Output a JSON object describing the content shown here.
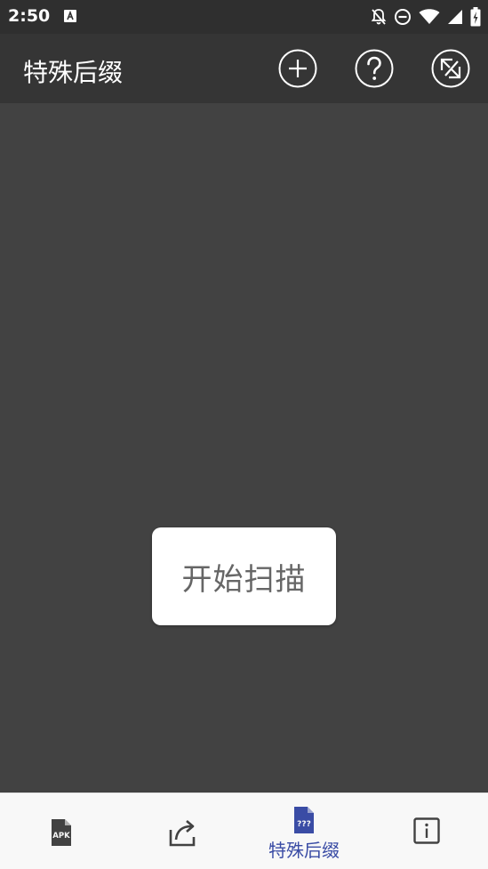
{
  "status_bar": {
    "time": "2:50"
  },
  "app_bar": {
    "title": "特殊后缀",
    "actions": [
      {
        "name": "add",
        "icon": "add-circle-icon"
      },
      {
        "name": "help",
        "icon": "help-circle-icon"
      },
      {
        "name": "switch",
        "icon": "swap-circle-icon"
      }
    ]
  },
  "main": {
    "scan_button_label": "开始扫描"
  },
  "bottom_nav": {
    "items": [
      {
        "icon": "apk-icon",
        "label": ""
      },
      {
        "icon": "share-icon",
        "label": ""
      },
      {
        "icon": "file-unknown-icon",
        "label": "特殊后缀",
        "selected": true
      },
      {
        "icon": "info-icon",
        "label": ""
      }
    ],
    "active_color": "#3a4ca5",
    "inactive_color": "#424242"
  },
  "colors": {
    "background": "#424242",
    "app_bar": "#353535",
    "status_bar": "#2f2f2f",
    "accent": "#3a4ca5"
  }
}
